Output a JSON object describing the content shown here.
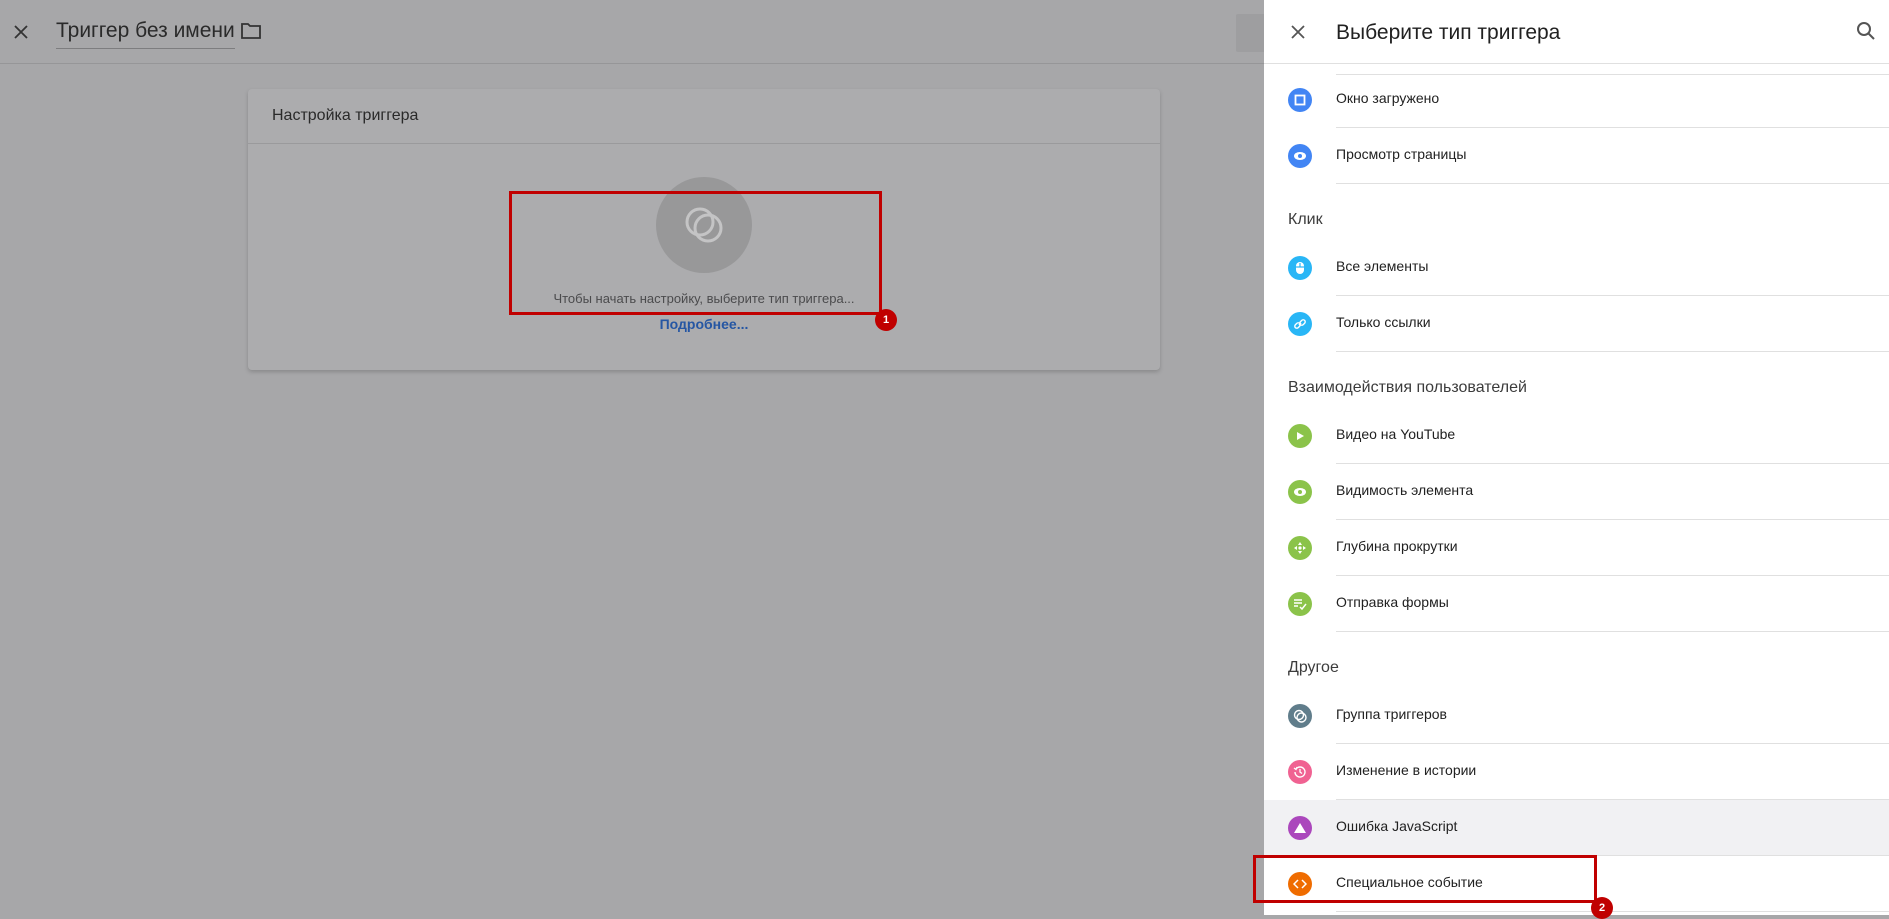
{
  "editor": {
    "title": "Триггер без имени",
    "card_title": "Настройка триггера",
    "hint": "Чтобы начать настройку, выберите тип триггера...",
    "more_link": "Подробнее..."
  },
  "panel": {
    "title": "Выберите тип триггера",
    "sections": [
      {
        "label": "",
        "items": [
          {
            "label": "Окно загружено",
            "icon": "window-icon",
            "color": "#4285f4"
          },
          {
            "label": "Просмотр страницы",
            "icon": "eye-icon",
            "color": "#4285f4"
          }
        ]
      },
      {
        "label": "Клик",
        "items": [
          {
            "label": "Все элементы",
            "icon": "mouse-icon",
            "color": "#29b6f6"
          },
          {
            "label": "Только ссылки",
            "icon": "link-icon",
            "color": "#29b6f6"
          }
        ]
      },
      {
        "label": "Взаимодействия пользователей",
        "items": [
          {
            "label": "Видео на YouTube",
            "icon": "play-icon",
            "color": "#8bc34a"
          },
          {
            "label": "Видимость элемента",
            "icon": "eye-icon",
            "color": "#8bc34a"
          },
          {
            "label": "Глубина прокрутки",
            "icon": "scroll-icon",
            "color": "#8bc34a"
          },
          {
            "label": "Отправка формы",
            "icon": "form-icon",
            "color": "#8bc34a"
          }
        ]
      },
      {
        "label": "Другое",
        "items": [
          {
            "label": "Группа триггеров",
            "icon": "trigger-group-icon",
            "color": "#607d8b"
          },
          {
            "label": "Изменение в истории",
            "icon": "history-icon",
            "color": "#f06292"
          },
          {
            "label": "Ошибка JavaScript",
            "icon": "warning-icon",
            "color": "#ab47bc"
          },
          {
            "label": "Специальное событие",
            "icon": "code-icon",
            "color": "#ef6c00"
          }
        ]
      }
    ]
  },
  "annotations": [
    "1",
    "2"
  ]
}
